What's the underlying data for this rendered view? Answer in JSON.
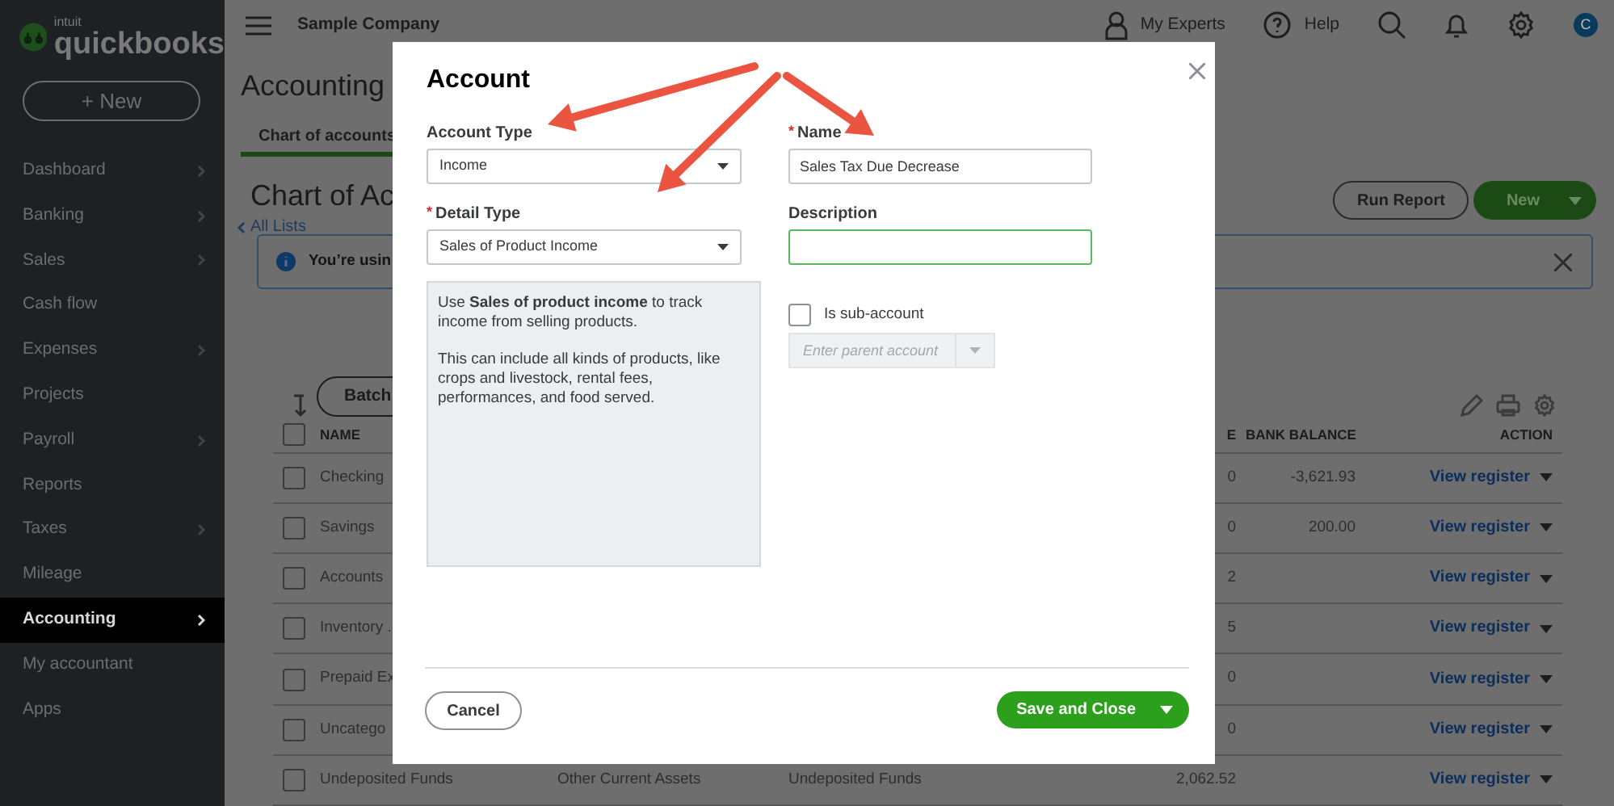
{
  "sidebar": {
    "logo_brand": "intuit",
    "logo": "quickbooks",
    "new_button": "+ New",
    "items": [
      {
        "label": "Dashboard",
        "has_submenu": true,
        "selected": false
      },
      {
        "label": "Banking",
        "has_submenu": true,
        "selected": false
      },
      {
        "label": "Sales",
        "has_submenu": true,
        "selected": false
      },
      {
        "label": "Cash flow",
        "has_submenu": false,
        "selected": false
      },
      {
        "label": "Expenses",
        "has_submenu": true,
        "selected": false
      },
      {
        "label": "Projects",
        "has_submenu": false,
        "selected": false
      },
      {
        "label": "Payroll",
        "has_submenu": true,
        "selected": false
      },
      {
        "label": "Reports",
        "has_submenu": false,
        "selected": false
      },
      {
        "label": "Taxes",
        "has_submenu": true,
        "selected": false
      },
      {
        "label": "Mileage",
        "has_submenu": false,
        "selected": false
      },
      {
        "label": "Accounting",
        "has_submenu": true,
        "selected": true
      },
      {
        "label": "My accountant",
        "has_submenu": false,
        "selected": false
      },
      {
        "label": "Apps",
        "has_submenu": false,
        "selected": false
      }
    ]
  },
  "topbar": {
    "company": "Sample Company",
    "my_experts": "My Experts",
    "help": "Help",
    "avatar": "C"
  },
  "page": {
    "title": "Accounting",
    "tabs": [
      {
        "label": "Chart of accounts",
        "selected": true
      }
    ],
    "heading": "Chart of Ac",
    "back_link": "All Lists",
    "banner": "You’re usin",
    "run_report": "Run Report",
    "new_button": "New",
    "batch_button": "Batch"
  },
  "table": {
    "select_all_checked": false,
    "columns": {
      "name": "NAME",
      "balance": "E",
      "bank_balance": "BANK BALANCE",
      "action": "ACTION"
    },
    "rows": [
      {
        "checked": false,
        "name": "Checking",
        "balance": "0",
        "bank_balance": "-3,621.93",
        "action": "View register"
      },
      {
        "checked": false,
        "name": "Savings",
        "balance": "0",
        "bank_balance": "200.00",
        "action": "View register"
      },
      {
        "checked": false,
        "name": "Accounts",
        "balance": "2",
        "action": "View register"
      },
      {
        "checked": false,
        "name": "Inventory .",
        "balance": "5",
        "action": "View register"
      },
      {
        "checked": false,
        "name": "Prepaid Ex",
        "balance": "0",
        "action": "View register"
      },
      {
        "checked": false,
        "name": "Uncatego",
        "balance": "0",
        "action": "View register"
      },
      {
        "checked": false,
        "name": "Undeposited Funds",
        "type": "Other Current Assets",
        "detail_type": "Undeposited Funds",
        "balance": "2,062.52",
        "action": "View register"
      }
    ]
  },
  "modal": {
    "title": "Account",
    "account_type": {
      "label": "Account Type",
      "value": "Income"
    },
    "detail_type": {
      "label": "Detail Type",
      "required_mark": "*",
      "value": "Sales of Product Income"
    },
    "name": {
      "label": "Name",
      "required_mark": "*",
      "value": "Sales Tax Due Decrease"
    },
    "description": {
      "label": "Description",
      "focused": true
    },
    "help_text": [
      "Use **Sales of product income** to track income from selling products.",
      "This can include all kinds of products, like crops and livestock, rental fees, performances, and food served."
    ],
    "sub_account": {
      "label": "Is sub-account",
      "checked": false
    },
    "parent_account": {
      "placeholder": "Enter parent account",
      "disabled": true
    },
    "cancel": "Cancel",
    "save": "Save and Close"
  }
}
